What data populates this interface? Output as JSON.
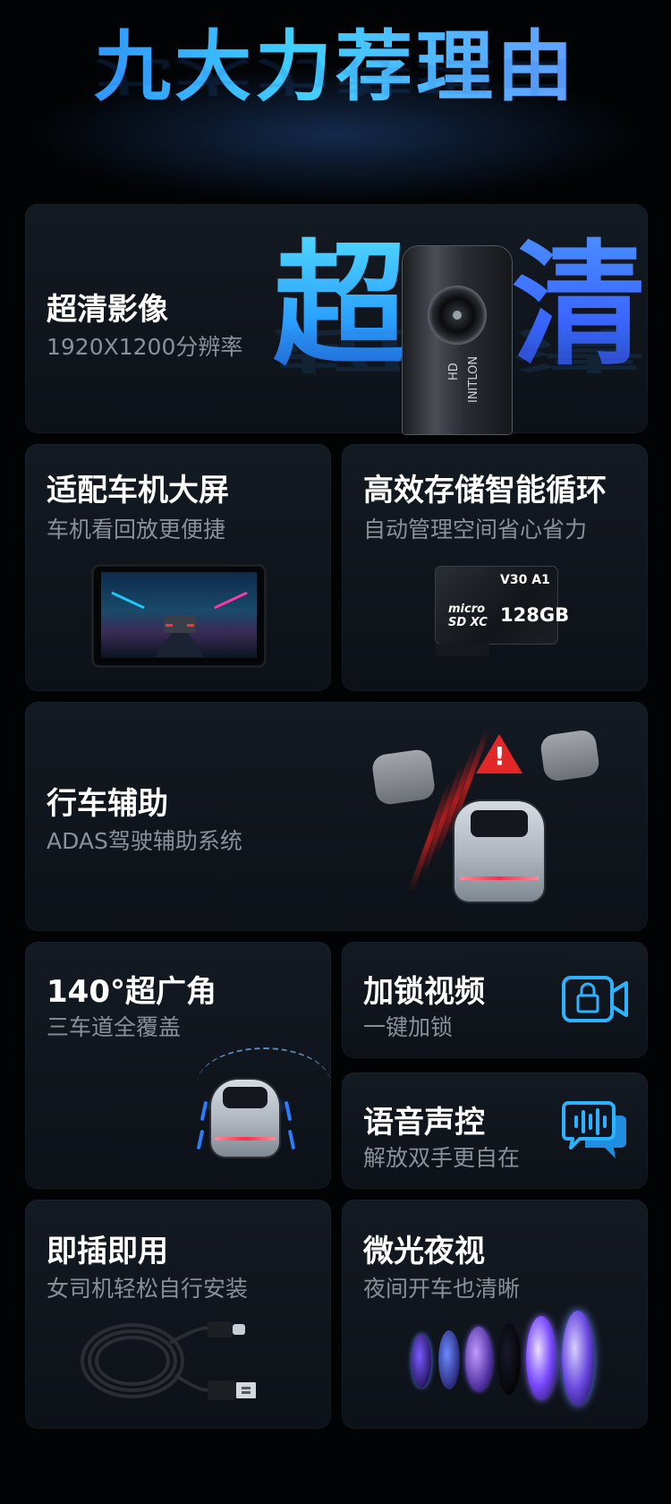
{
  "page_title": "九大力荐理由",
  "cards": {
    "hd": {
      "title": "超清影像",
      "subtitle": "1920X1200分辨率",
      "big_left": "超",
      "big_right": "清",
      "camera_label_1": "HD",
      "camera_label_2": "INITLON"
    },
    "screen": {
      "title": "适配车机大屏",
      "subtitle": "车机看回放更便捷"
    },
    "storage": {
      "title": "高效存储智能循环",
      "subtitle": "自动管理空间省心省力",
      "sd_speed": "V30 A1",
      "sd_brand": "micro SD XC",
      "sd_capacity": "128GB"
    },
    "adas": {
      "title": "行车辅助",
      "subtitle": "ADAS驾驶辅助系统",
      "warning_symbol": "!"
    },
    "wide": {
      "title": "140°超广角",
      "subtitle": "三车道全覆盖"
    },
    "lock": {
      "title": "加锁视频",
      "subtitle": "一键加锁",
      "icon": "lock-camera-icon"
    },
    "voice": {
      "title": "语音声控",
      "subtitle": "解放双手更自在",
      "icon": "voice-chat-icon"
    },
    "plug": {
      "title": "即插即用",
      "subtitle": "女司机轻松自行安装"
    },
    "night": {
      "title": "微光夜视",
      "subtitle": "夜间开车也清晰"
    }
  },
  "colors": {
    "accent_blue": "#2a9dff",
    "icon_cyan": "#2ab4ff",
    "warning_red": "#e32626",
    "card_bg": "#11161d"
  }
}
